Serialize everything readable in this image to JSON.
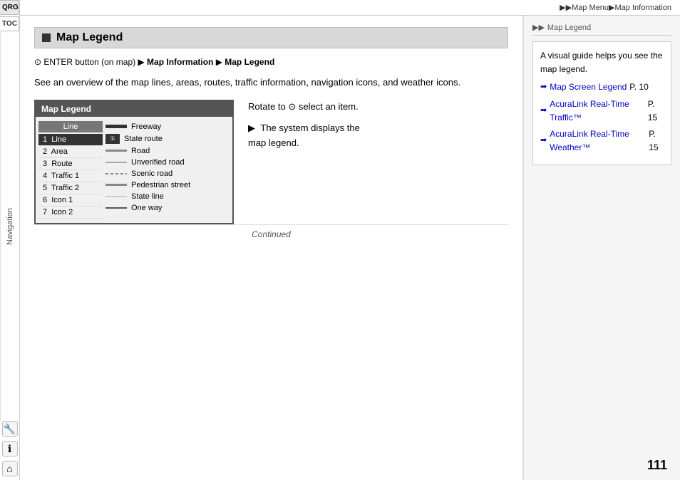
{
  "breadcrumb": {
    "prefix": "▶▶",
    "items": [
      "Map Menu",
      "Map Information"
    ],
    "separator": "▶"
  },
  "section": {
    "title": "Map Legend",
    "icon": "■"
  },
  "path_line": {
    "enter_icon": "⊙",
    "text": "ENTER button (on map)",
    "arrow": "▶",
    "step1": "Map Information",
    "step2": "Map Legend"
  },
  "description": "See an overview of the map lines, areas, routes, traffic information, navigation icons, and weather icons.",
  "map_legend_header": "Map Legend",
  "map_legend_columns": {
    "left_header": "Line",
    "left_items": [
      {
        "number": "2",
        "label": "Area",
        "selected": false
      },
      {
        "number": "3",
        "label": "Route",
        "selected": false
      },
      {
        "number": "4",
        "label": "Traffic 1",
        "selected": false
      },
      {
        "number": "5",
        "label": "Traffic 2",
        "selected": false
      },
      {
        "number": "6",
        "label": "Icon 1",
        "selected": false
      },
      {
        "number": "7",
        "label": "Icon 2",
        "selected": false
      }
    ],
    "right_items": [
      {
        "line_type": "thick",
        "label": "Freeway"
      },
      {
        "line_type": "icon",
        "label": "State route"
      },
      {
        "line_type": "medium",
        "label": "Road"
      },
      {
        "line_type": "thin",
        "label": "Unverified road"
      },
      {
        "line_type": "dashed",
        "label": "Scenic road"
      },
      {
        "line_type": "medium",
        "label": "Pedestrian street"
      },
      {
        "line_type": "state-line",
        "label": "State line"
      },
      {
        "line_type": "oneway",
        "label": "One way"
      }
    ]
  },
  "instruction": {
    "rotate_icon": "⊙",
    "rotate_text": "Rotate to",
    "rotate_suffix": "select an item.",
    "bullet": "▶",
    "result_text": "The system displays the map legend."
  },
  "footer": {
    "continued": "Continued",
    "page_number": "111"
  },
  "sidebar": {
    "section_title_prefix": "▶▶",
    "section_title": "Map Legend",
    "intro_text": "A visual guide helps you see the map legend.",
    "links": [
      {
        "arrow": "➡",
        "text": "Map Screen Legend",
        "page_label": "P. 10"
      },
      {
        "arrow": "➡",
        "text": "AcuraLink Real-Time Traffic™",
        "page_label": "P. 15"
      },
      {
        "arrow": "➡",
        "text": "AcuraLink Real-Time Weather™",
        "page_label": "P. 15"
      }
    ]
  },
  "left_sidebar": {
    "qrg_label": "QRG",
    "toc_label": "TOC",
    "nav_label": "Navigation",
    "icon_wrench": "🔧",
    "icon_info": "ℹ",
    "icon_home": "⌂"
  }
}
